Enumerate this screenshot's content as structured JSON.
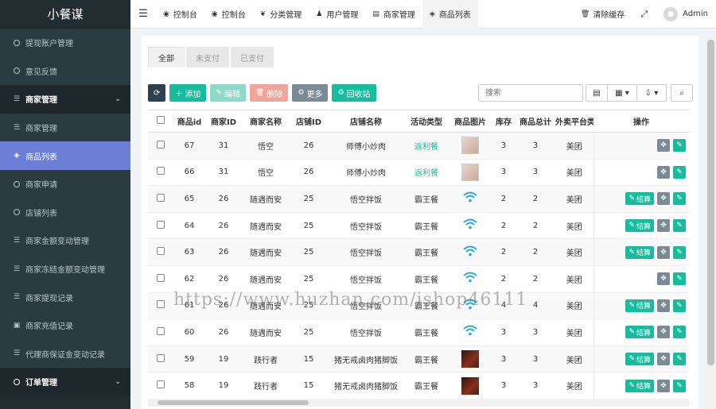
{
  "brand": "小餐谋",
  "sidebar": {
    "items": [
      {
        "label": "提现账户管理",
        "icon": "circle-icon",
        "type": "item"
      },
      {
        "label": "意见反馈",
        "icon": "circle-icon",
        "type": "item"
      },
      {
        "label": "商家管理",
        "icon": "menu-icon",
        "type": "group"
      },
      {
        "label": "商家管理",
        "icon": "list-icon",
        "type": "item"
      },
      {
        "label": "商品列表",
        "icon": "cubes-icon",
        "type": "active"
      },
      {
        "label": "商家申请",
        "icon": "circle-icon",
        "type": "item"
      },
      {
        "label": "店铺列表",
        "icon": "circle-icon",
        "type": "item"
      },
      {
        "label": "商家金额变动管理",
        "icon": "list-icon",
        "type": "item"
      },
      {
        "label": "商家冻结金额变动管理",
        "icon": "list-icon",
        "type": "item"
      },
      {
        "label": "商家提现记录",
        "icon": "list-icon",
        "type": "item"
      },
      {
        "label": "商家充值记录",
        "icon": "money-icon",
        "type": "item"
      },
      {
        "label": "代理商保证金变动记录",
        "icon": "list-icon",
        "type": "item"
      },
      {
        "label": "订单管理",
        "icon": "circle-icon",
        "type": "group"
      }
    ]
  },
  "topbar": {
    "tabs": [
      "控制台",
      "控制台",
      "分类管理",
      "用户管理",
      "商家管理",
      "商品列表"
    ],
    "clear_cache": "清除缓存",
    "user": "Admin"
  },
  "subtabs": [
    "全部",
    "未支付",
    "已支付"
  ],
  "toolbar": {
    "add": "添加",
    "edit": "编辑",
    "delete": "删除",
    "more": "更多",
    "recycle": "回收站",
    "search_placeholder": "搜索"
  },
  "table": {
    "headers": [
      "商品id",
      "商家ID",
      "商家名称",
      "店铺ID",
      "店铺名称",
      "活动类型",
      "商品图片",
      "库存",
      "商品总计",
      "外卖平台类",
      "操作"
    ],
    "settle_label": "结算",
    "rows": [
      {
        "id": "67",
        "merchant_id": "31",
        "merchant_name": "悟空",
        "shop_id": "26",
        "shop_name": "师傅小炒肉",
        "activity": "返利餐",
        "img": "noodle",
        "stock": "3",
        "total": "3",
        "platform": "美团",
        "settle": false
      },
      {
        "id": "66",
        "merchant_id": "31",
        "merchant_name": "悟空",
        "shop_id": "26",
        "shop_name": "师傅小炒肉",
        "activity": "返利餐",
        "img": "noodle",
        "stock": "3",
        "total": "3",
        "platform": "美团",
        "settle": false
      },
      {
        "id": "65",
        "merchant_id": "26",
        "merchant_name": "随遇而安",
        "shop_id": "25",
        "shop_name": "悟空拌饭",
        "activity": "霸王餐",
        "img": "wifi",
        "stock": "2",
        "total": "2",
        "platform": "美团",
        "settle": true
      },
      {
        "id": "64",
        "merchant_id": "26",
        "merchant_name": "随遇而安",
        "shop_id": "25",
        "shop_name": "悟空拌饭",
        "activity": "霸王餐",
        "img": "wifi",
        "stock": "2",
        "total": "2",
        "platform": "美团",
        "settle": true
      },
      {
        "id": "63",
        "merchant_id": "26",
        "merchant_name": "随遇而安",
        "shop_id": "25",
        "shop_name": "悟空拌饭",
        "activity": "霸王餐",
        "img": "wifi",
        "stock": "2",
        "total": "2",
        "platform": "美团",
        "settle": true
      },
      {
        "id": "62",
        "merchant_id": "26",
        "merchant_name": "随遇而安",
        "shop_id": "25",
        "shop_name": "悟空拌饭",
        "activity": "霸王餐",
        "img": "wifi",
        "stock": "2",
        "total": "2",
        "platform": "美团",
        "settle": false
      },
      {
        "id": "61",
        "merchant_id": "26",
        "merchant_name": "随遇而安",
        "shop_id": "25",
        "shop_name": "悟空拌饭",
        "activity": "霸王餐",
        "img": "wifi",
        "stock": "4",
        "total": "4",
        "platform": "美团",
        "settle": true
      },
      {
        "id": "60",
        "merchant_id": "26",
        "merchant_name": "随遇而安",
        "shop_id": "25",
        "shop_name": "悟空拌饭",
        "activity": "霸王餐",
        "img": "wifi",
        "stock": "3",
        "total": "3",
        "platform": "美团",
        "settle": true
      },
      {
        "id": "59",
        "merchant_id": "19",
        "merchant_name": "践行者",
        "shop_id": "15",
        "shop_name": "猪无戒卤肉猪脚饭",
        "activity": "霸王餐",
        "img": "dark",
        "stock": "3",
        "total": "3",
        "platform": "美团",
        "settle": true
      },
      {
        "id": "58",
        "merchant_id": "19",
        "merchant_name": "践行者",
        "shop_id": "15",
        "shop_name": "猪无戒卤肉猪脚饭",
        "activity": "霸王餐",
        "img": "dark",
        "stock": "3",
        "total": "3",
        "platform": "美团",
        "settle": true
      }
    ]
  },
  "watermark": "https://www.huzhan.com/ishop46111",
  "colors": {
    "sidebar_bg": "#222d32",
    "active": "#6b7fd7",
    "accent_green": "#18bc9c",
    "dark_btn": "#2f4050"
  }
}
